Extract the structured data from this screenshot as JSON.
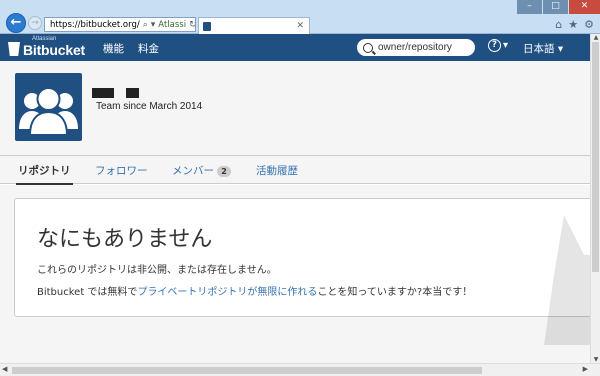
{
  "browser": {
    "url": "https://bitbucket.org/",
    "site_identity": "Atlassi",
    "tab_title": "",
    "window_controls": [
      "–",
      "□",
      "✕"
    ],
    "toolbar_icons": [
      "home-icon",
      "star-icon",
      "gear-icon"
    ]
  },
  "header": {
    "logo_small": "Atlassian",
    "logo": "Bitbucket",
    "nav": [
      "機能",
      "料金"
    ],
    "search_placeholder": "owner/repository",
    "help_label": "?",
    "help_caret": "▾",
    "language": "日本語 ▾"
  },
  "profile": {
    "team_since": "Team since March 2014"
  },
  "tabs": [
    {
      "label": "リポジトリ",
      "active": true
    },
    {
      "label": "フォロワー",
      "active": false
    },
    {
      "label": "メンバー",
      "count": "2",
      "active": false
    },
    {
      "label": "活動履歴",
      "active": false
    }
  ],
  "empty_state": {
    "title": "なにもありません",
    "message": "これらのリポジトリは非公開、または存在しません。",
    "promo_prefix": "Bitbucket では無料で",
    "promo_link": "プライベートリポジトリが無限に作れる",
    "promo_suffix": "ことを知っていますか?本当です！"
  },
  "colors": {
    "brand": "#205081",
    "link": "#3572b0",
    "page_bg": "#f5f5f5"
  }
}
